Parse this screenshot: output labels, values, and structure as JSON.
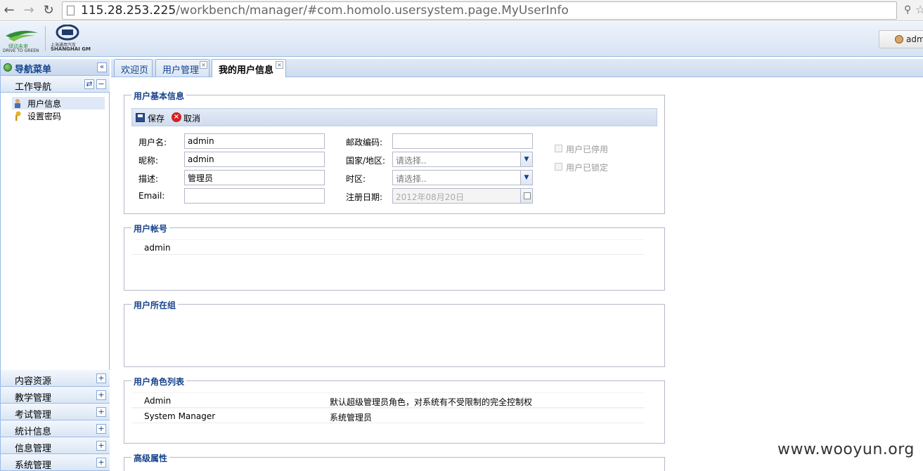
{
  "browser": {
    "url_host": "115.28.253.225",
    "url_path": "/workbench/manager/#com.homolo.usersystem.page.MyUserInfo"
  },
  "header": {
    "logo1_text": "DRIVE TO GREEN",
    "logo1_cn": "绿动未来",
    "logo2_cn": "上海通用汽车",
    "logo2_text": "SHANGHAI GM",
    "user": "adm"
  },
  "sidebar": {
    "title": "导航菜单",
    "work_nav": {
      "label": "工作导航",
      "items": [
        {
          "label": "用户信息",
          "icon": "user-icon"
        },
        {
          "label": "设置密码",
          "icon": "key-icon"
        }
      ]
    },
    "panels": [
      {
        "label": "内容资源"
      },
      {
        "label": "教学管理"
      },
      {
        "label": "考试管理"
      },
      {
        "label": "统计信息"
      },
      {
        "label": "信息管理"
      },
      {
        "label": "系统管理"
      }
    ]
  },
  "tabs": [
    {
      "label": "欢迎页",
      "closable": false
    },
    {
      "label": "用户管理",
      "closable": true
    },
    {
      "label": "我的用户信息",
      "closable": true,
      "active": true
    }
  ],
  "basic_info": {
    "legend": "用户基本信息",
    "toolbar": {
      "save": "保存",
      "cancel": "取消"
    },
    "fields": {
      "username_label": "用户名:",
      "username_value": "admin",
      "nickname_label": "昵称:",
      "nickname_value": "admin",
      "desc_label": "描述:",
      "desc_value": "管理员",
      "email_label": "Email:",
      "email_value": "",
      "postcode_label": "邮政编码:",
      "postcode_value": "",
      "country_label": "国家/地区:",
      "country_value": "请选择..",
      "timezone_label": "时区:",
      "timezone_value": "请选择..",
      "regdate_label": "注册日期:",
      "regdate_value": "2012年08月20日"
    },
    "checkboxes": {
      "disabled_label": "用户已停用",
      "locked_label": "用户已锁定"
    }
  },
  "accounts": {
    "legend": "用户帐号",
    "rows": [
      {
        "name": "admin"
      }
    ]
  },
  "groups": {
    "legend": "用户所在组"
  },
  "roles": {
    "legend": "用户角色列表",
    "rows": [
      {
        "name": "Admin",
        "desc": "默认超级管理员角色，对系统有不受限制的完全控制权"
      },
      {
        "name": "System Manager",
        "desc": "系统管理员"
      }
    ]
  },
  "advanced": {
    "legend": "高级属性"
  },
  "watermark": "www.wooyun.org",
  "colors": {
    "accent": "#15428b",
    "border": "#99bbe8"
  }
}
